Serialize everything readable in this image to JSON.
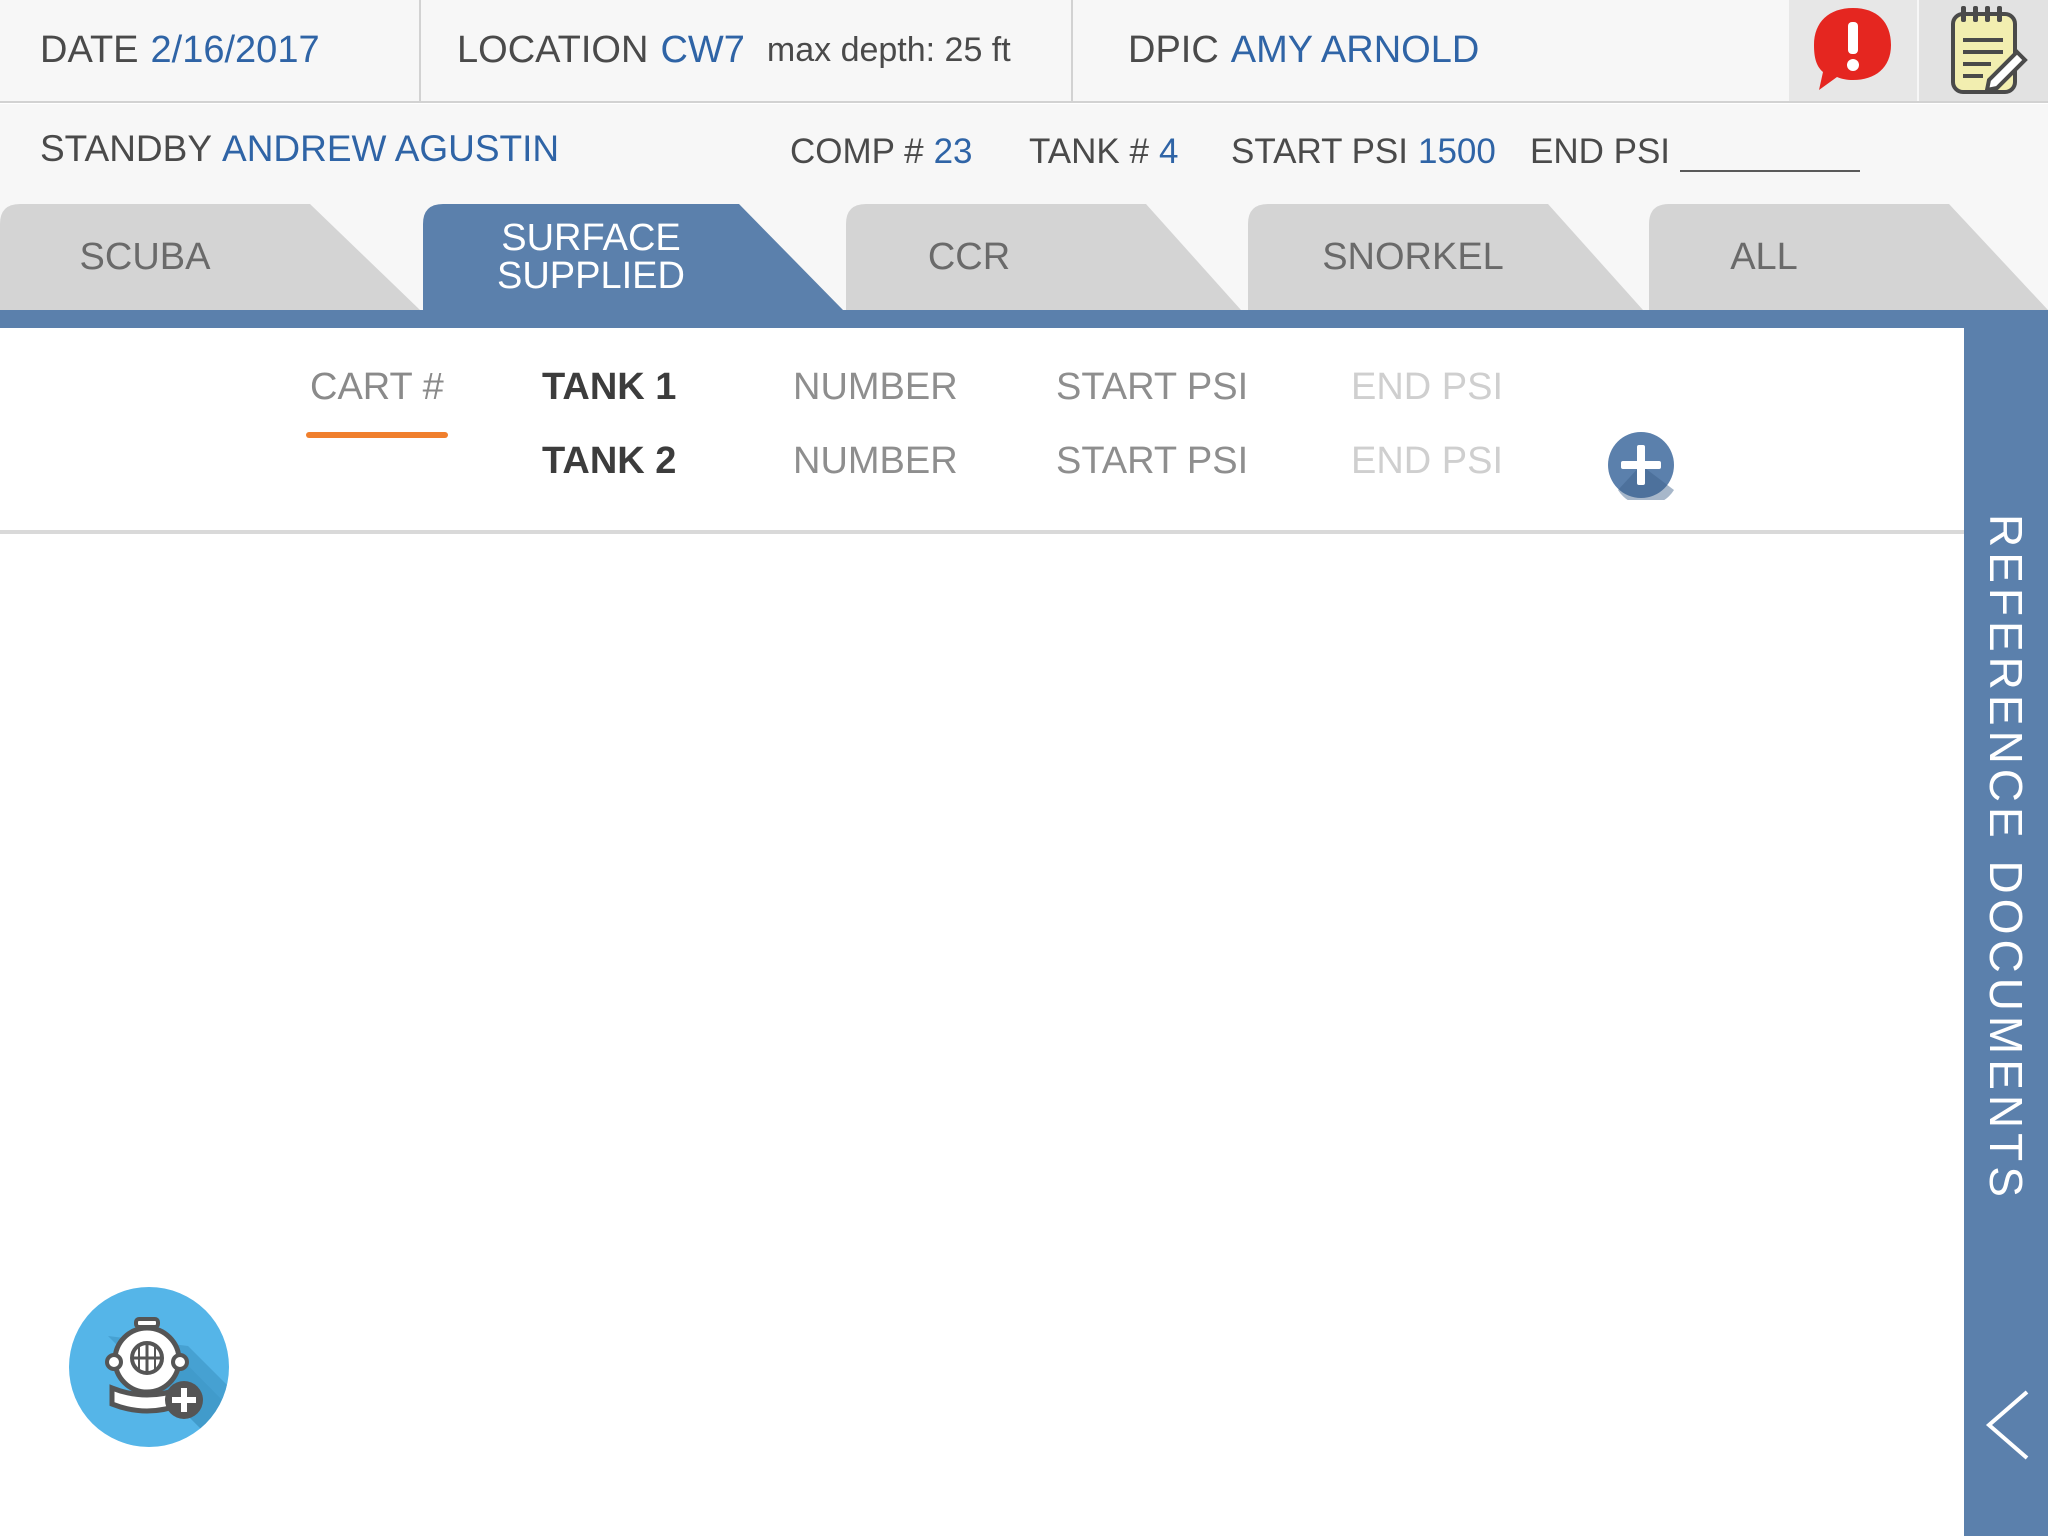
{
  "header": {
    "date_label": "DATE",
    "date_value": "2/16/2017",
    "location_label": "LOCATION",
    "location_value": "CW7",
    "max_depth": "max depth: 25 ft",
    "dpic_label": "DPIC",
    "dpic_value": "AMY ARNOLD",
    "icons": {
      "alert": "alert-bubble-icon",
      "notes": "notepad-icon"
    }
  },
  "info": {
    "standby_label": "STANDBY",
    "standby_value": "ANDREW AGUSTIN",
    "comp_label": "COMP #",
    "comp_value": "23",
    "tank_label": "TANK #",
    "tank_value": "4",
    "start_psi_label": "START PSI",
    "start_psi_value": "1500",
    "end_psi_label": "END PSI"
  },
  "tabs": [
    {
      "line1": "SCUBA",
      "line2": "",
      "active": false
    },
    {
      "line1": "SURFACE",
      "line2": "SUPPLIED",
      "active": true
    },
    {
      "line1": "CCR",
      "line2": "",
      "active": false
    },
    {
      "line1": "SNORKEL",
      "line2": "",
      "active": false
    },
    {
      "line1": "ALL",
      "line2": "",
      "active": false
    }
  ],
  "tank_table": {
    "cart_placeholder": "CART #",
    "rows": [
      {
        "name": "TANK 1",
        "number": "NUMBER",
        "start_psi": "START PSI",
        "end_psi": "END PSI"
      },
      {
        "name": "TANK 2",
        "number": "NUMBER",
        "start_psi": "START PSI",
        "end_psi": "END PSI"
      }
    ],
    "add_icon": "plus-circle-icon"
  },
  "side_panel": {
    "label": "REFERENCE DOCUMENTS",
    "icon": "chevron-left-icon"
  },
  "fab": {
    "icon": "diver-helmet-add-icon"
  },
  "colors": {
    "accent_blue": "#5b80ac",
    "value_blue": "#2f64a6",
    "underline_orange": "#f07f2d",
    "alert_red": "#e52620",
    "fab_blue": "#55b5e8"
  }
}
